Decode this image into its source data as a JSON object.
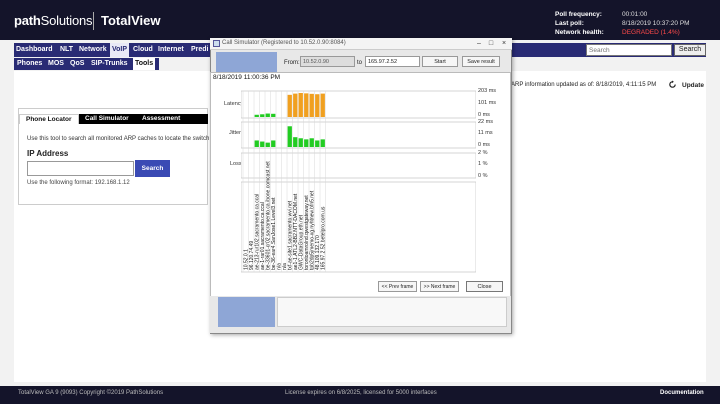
{
  "header": {
    "logo_bold": "path",
    "logo_thin": "Solutions",
    "product": "TotalView",
    "stats": [
      {
        "label": "Poll frequency:",
        "value": "00:01:00"
      },
      {
        "label": "Last poll:",
        "value": "8/18/2019 10:37:20 PM"
      },
      {
        "label": "Network health:",
        "value": "DEGRADED (1.4%)"
      }
    ],
    "search_button": "Search",
    "search_placeholder": "Search"
  },
  "nav": {
    "items": [
      "Dashboard",
      "NLT",
      "Network",
      "VoIP",
      "Cloud",
      "Internet",
      "Predi"
    ],
    "active": "VoIP"
  },
  "subnav": {
    "items": [
      "Phones",
      "MOS",
      "QoS",
      "SIP-Trunks",
      "Tools"
    ],
    "active": "Tools"
  },
  "main": {
    "arp_text": "ARP information updated as of: 8/18/2019, 4:11:15 PM",
    "update_label": "Update",
    "tabs": [
      "Phone Locator",
      "Call Simulator",
      "Assessment"
    ],
    "tool_description": "Use this tool to search all monitored ARP caches to locate the switch",
    "ip_label": "IP Address",
    "search_ip_button": "Search",
    "format_hint": "Use the following format: 192.168.1.12"
  },
  "simulator": {
    "title": "Call Simulator (Registered to 10.52.0.90:8084)",
    "from_label": "From:",
    "from_value": "10.52.0.90",
    "to_label": "to",
    "to_value": "165.97.2.52",
    "start_label": "Start",
    "save_label": "Save result",
    "timestamp": "8/18/2019 11:00:36 PM",
    "metrics": [
      "Latency",
      "Jitter",
      "Loss"
    ],
    "latency_scale": [
      "203 ms",
      "101 ms",
      "0 ms"
    ],
    "jitter_scale": [
      "22 ms",
      "11 ms",
      "0 ms"
    ],
    "loss_scale": [
      "2 %",
      "1 %",
      "0 %"
    ],
    "prev_label": "<< Prev frame",
    "next_label": ">> Next frame",
    "close_label": "Close",
    "win_min": "–",
    "win_max": "□",
    "win_close": "×"
  },
  "chart_data": {
    "type": "bar",
    "categories": [
      "10.52.0.1",
      "96.120.74.49",
      "ae-213-rur102.sacramento.ca.ccal",
      "ae-1-rar01.sacramento.ca.ccal",
      "be-33601-cr02.sacramento.ca.ibone.comcast.net",
      "be-36-ear4.SanJose1.Level3.net",
      "n/a",
      "n/a",
      "txf-ae-site1.sacramento.wvi.net",
      "ae1-1.ATL2-BB2.NTT-DACOM.net",
      "GWC-DataGroup.eth.net",
      "torontoamrolnd.qwestgateway.net",
      "tpb2dp5jmemo-xg.nyhtnew.bfn5.net",
      "48.109.132.170",
      "165.97.2.52.betelpro.com.us"
    ],
    "series": [
      {
        "name": "Latency",
        "values": [
          0,
          0,
          18,
          22,
          28,
          26,
          0,
          0,
          180,
          190,
          195,
          192,
          188,
          185,
          190
        ],
        "ylim": [
          0,
          203
        ]
      },
      {
        "name": "Jitter",
        "values": [
          0,
          0,
          6,
          5,
          4,
          6,
          0,
          0,
          19,
          9,
          8,
          7,
          8,
          6,
          7
        ],
        "ylim": [
          0,
          22
        ]
      },
      {
        "name": "Loss",
        "values": [
          0,
          0,
          0,
          0,
          0,
          0,
          0,
          0,
          0,
          0,
          0,
          0,
          0,
          0,
          0
        ],
        "ylim": [
          0,
          2
        ]
      }
    ]
  },
  "footer": {
    "copyright": "TotalView GA 9 (9093) Copyright ©2019 PathSolutions",
    "license": "License expires on 6/8/2025, licensed for 5000 interfaces",
    "documentation": "Documentation"
  },
  "colors": {
    "header_bg": "#14142a",
    "nav_bg": "#292b74",
    "degraded": "#ff4a4a",
    "good_bar": "#22cc22",
    "warn_bar": "#f0a020"
  }
}
